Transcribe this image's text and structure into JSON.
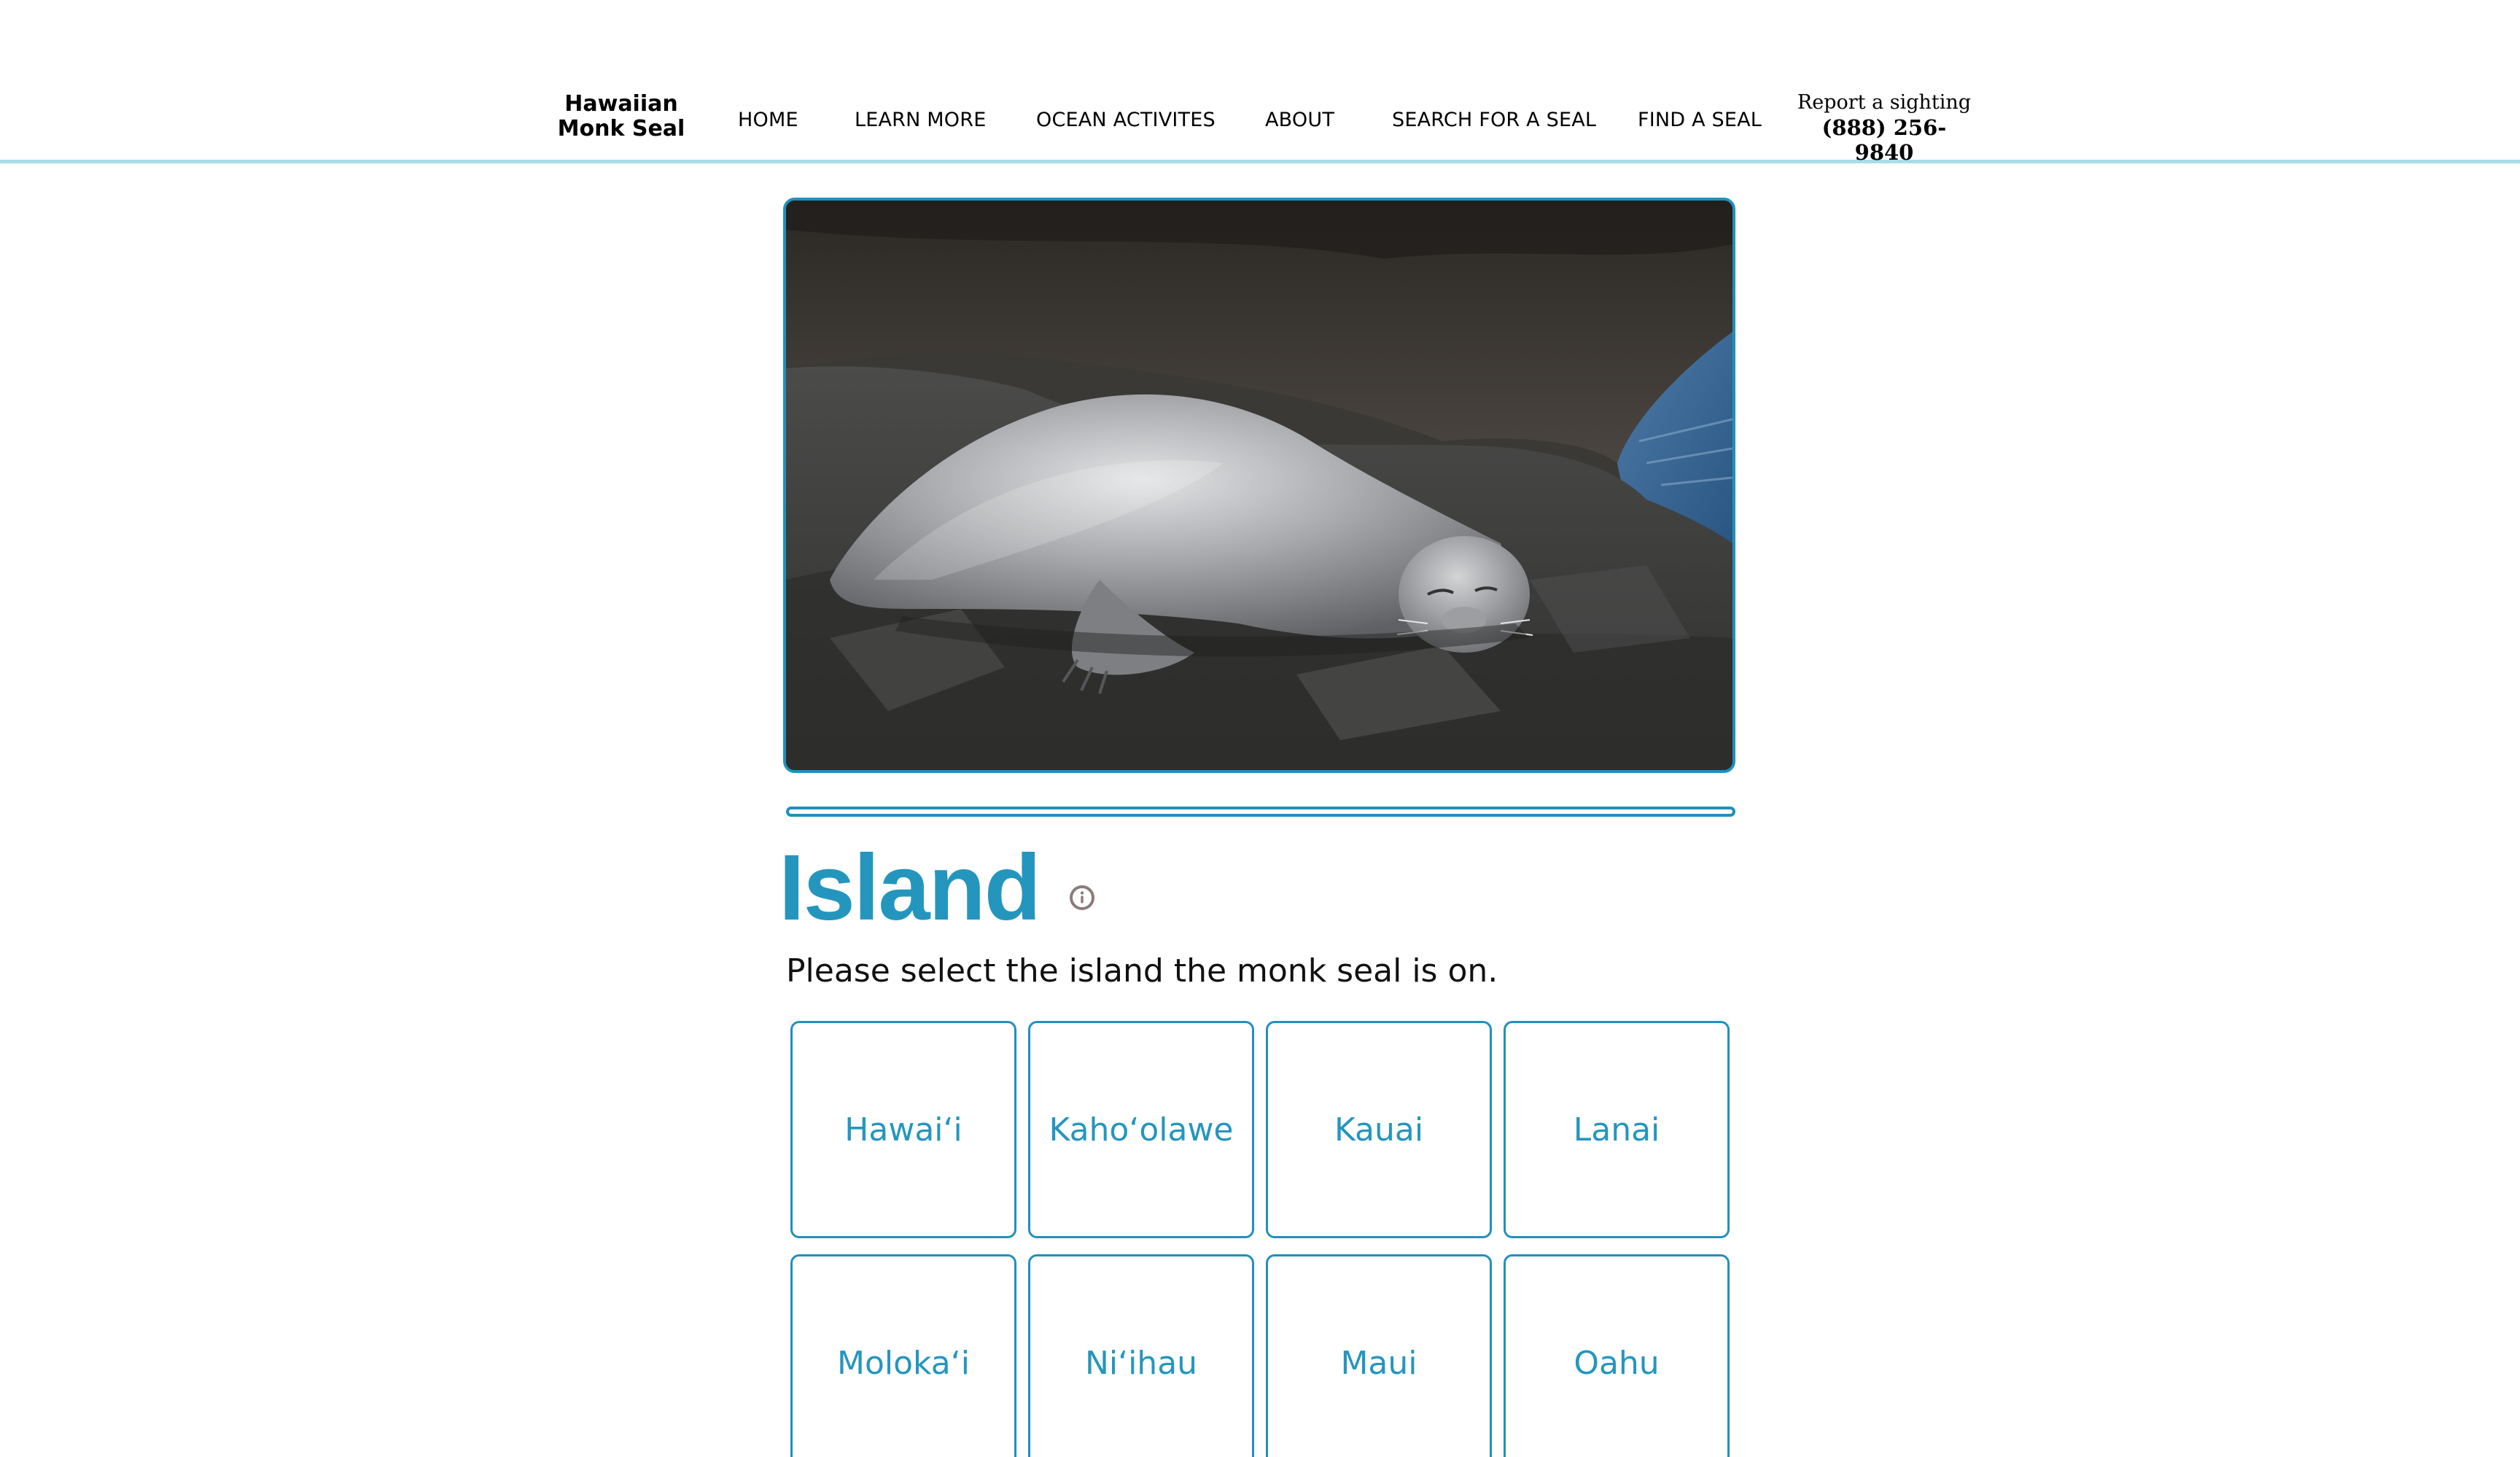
{
  "brand": {
    "line1": "Hawaiian",
    "line2": "Monk Seal"
  },
  "nav": {
    "items": [
      {
        "label": "HOME"
      },
      {
        "label": "LEARN MORE"
      },
      {
        "label": "OCEAN ACTIVITES"
      },
      {
        "label": "ABOUT"
      },
      {
        "label": "SEARCH FOR A SEAL"
      },
      {
        "label": "FIND A SEAL"
      }
    ],
    "report": {
      "label": "Report a sighting",
      "phone": "(888) 256-9840"
    }
  },
  "photo": {
    "subject": "Hawaiian monk seal resting on lava rocks"
  },
  "progress": {
    "fraction": 0.0
  },
  "question": {
    "title": "Island",
    "description": "Please select the island the monk seal is on."
  },
  "options": [
    {
      "label": "Hawai‘i"
    },
    {
      "label": "Kaho‘olawe"
    },
    {
      "label": "Kauai"
    },
    {
      "label": "Lanai"
    },
    {
      "label": "Moloka‘i"
    },
    {
      "label": "Ni‘ihau"
    },
    {
      "label": "Maui"
    },
    {
      "label": "Oahu"
    }
  ],
  "colors": {
    "accent": "#2190bd",
    "title": "#2496be",
    "header_rule": "#a9dde7",
    "info_icon": "#8a7b7b"
  },
  "icons": {
    "info": "info-icon"
  }
}
